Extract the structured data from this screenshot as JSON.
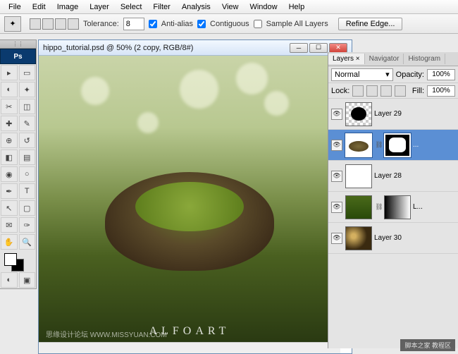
{
  "menu": {
    "items": [
      "File",
      "Edit",
      "Image",
      "Layer",
      "Select",
      "Filter",
      "Analysis",
      "View",
      "Window",
      "Help"
    ]
  },
  "options": {
    "tolerance_label": "Tolerance:",
    "tolerance_value": "8",
    "antialias": "Anti-alias",
    "contiguous": "Contiguous",
    "sample_all": "Sample All Layers",
    "refine": "Refine Edge..."
  },
  "app_badge": "Ps",
  "document": {
    "title": "hippo_tutorial.psd @ 50% (2 copy, RGB/8#)",
    "watermark": "ALFOART",
    "watermark_small": "思缘设计论坛  WWW.MISSYUAN.COM"
  },
  "panels": {
    "tabs": [
      "Layers ×",
      "Navigator",
      "Histogram"
    ],
    "blend_mode": "Normal",
    "opacity_label": "Opacity:",
    "opacity_value": "100%",
    "lock_label": "Lock:",
    "fill_label": "Fill:",
    "fill_value": "100%",
    "layers": [
      {
        "name": "Layer 29"
      },
      {
        "name": "..."
      },
      {
        "name": "Layer 28"
      },
      {
        "name": "L..."
      },
      {
        "name": "Layer 30"
      }
    ]
  },
  "footer_badge": "脚本之家 教程区"
}
